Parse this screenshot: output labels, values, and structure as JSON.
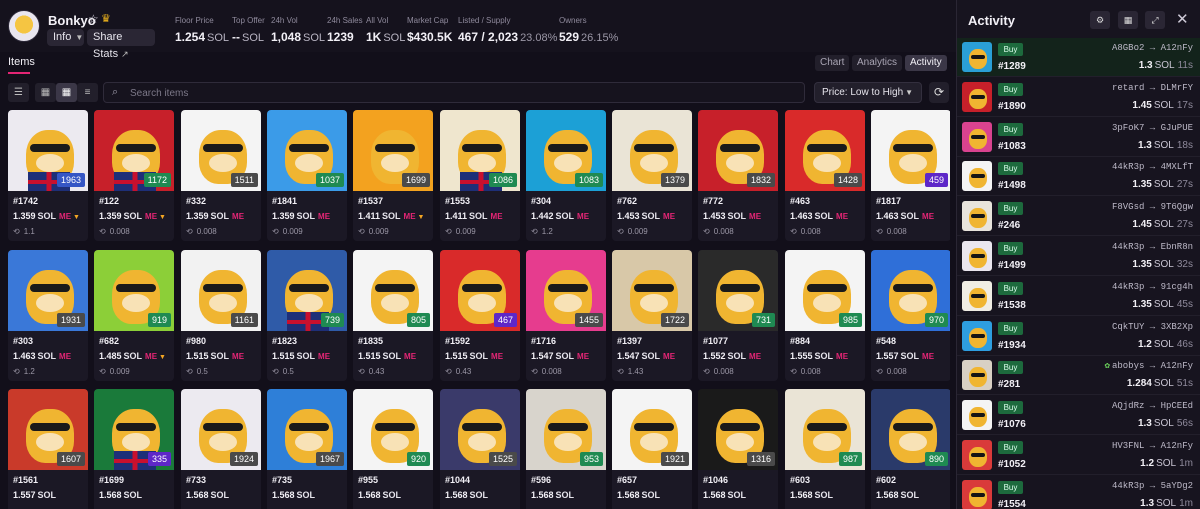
{
  "collection": {
    "name": "Bonkyo",
    "info_label": "Info",
    "share_label": "Share Stats"
  },
  "stats": [
    {
      "label": "Floor Price",
      "value": "1.254",
      "unit": "SOL",
      "pct": ""
    },
    {
      "label": "Top Offer",
      "value": "--",
      "unit": "SOL",
      "pct": ""
    },
    {
      "label": "24h Vol",
      "value": "1,048",
      "unit": "SOL",
      "pct": ""
    },
    {
      "label": "24h Sales",
      "value": "1239",
      "unit": "",
      "pct": ""
    },
    {
      "label": "All Vol",
      "value": "1K",
      "unit": "SOL",
      "pct": ""
    },
    {
      "label": "Market Cap",
      "value": "$430.5K",
      "unit": "",
      "pct": ""
    },
    {
      "label": "Listed / Supply",
      "value": "467 / 2,023",
      "unit": "",
      "pct": "23.08%"
    },
    {
      "label": "Owners",
      "value": "529",
      "unit": "",
      "pct": "26.15%"
    }
  ],
  "tabs": {
    "items": "Items"
  },
  "views": {
    "chart": "Chart",
    "analytics": "Analytics",
    "activity": "Activity"
  },
  "search": {
    "placeholder": "Search items"
  },
  "sort": {
    "selected": "Price: Low to High"
  },
  "unit": "SOL",
  "grid": [
    {
      "id": "#1742",
      "price": "1.359",
      "last": "1.1",
      "rank": "1963",
      "rank_color": "blue",
      "flag": true,
      "bg": "#eceaf0"
    },
    {
      "id": "#122",
      "price": "1.359",
      "last": "0.008",
      "rank": "1172",
      "rank_color": "green",
      "flag": true,
      "bg": "#c7202a"
    },
    {
      "id": "#332",
      "price": "1.359",
      "last": "0.008",
      "rank": "1511",
      "rank_color": "gray",
      "flag": false,
      "bg": "#f4f4f4"
    },
    {
      "id": "#1841",
      "price": "1.359",
      "last": "0.009",
      "rank": "1037",
      "rank_color": "green",
      "flag": false,
      "bg": "#3b9be8"
    },
    {
      "id": "#1537",
      "price": "1.411",
      "last": "0.009",
      "rank": "1699",
      "rank_color": "gray",
      "flag": false,
      "bg": "#f3a21f"
    },
    {
      "id": "#1553",
      "price": "1.411",
      "last": "0.009",
      "rank": "1086",
      "rank_color": "green",
      "flag": true,
      "bg": "#efe6ce"
    },
    {
      "id": "#304",
      "price": "1.442",
      "last": "1.2",
      "rank": "1083",
      "rank_color": "green",
      "flag": false,
      "bg": "#1ca0d6"
    },
    {
      "id": "#762",
      "price": "1.453",
      "last": "0.009",
      "rank": "1379",
      "rank_color": "gray",
      "flag": false,
      "bg": "#eae4d6"
    },
    {
      "id": "#772",
      "price": "1.453",
      "last": "0.008",
      "rank": "1832",
      "rank_color": "gray",
      "flag": false,
      "bg": "#c7202a"
    },
    {
      "id": "#463",
      "price": "1.463",
      "last": "0.008",
      "rank": "1428",
      "rank_color": "gray",
      "flag": false,
      "bg": "#d92a2a"
    },
    {
      "id": "#1817",
      "price": "1.463",
      "last": "0.008",
      "rank": "459",
      "rank_color": "purple",
      "flag": false,
      "bg": "#f4f4f4"
    },
    {
      "id": "#303",
      "price": "1.463",
      "last": "1.2",
      "rank": "1931",
      "rank_color": "gray",
      "flag": false,
      "bg": "#3a78d8"
    },
    {
      "id": "#682",
      "price": "1.485",
      "last": "0.009",
      "rank": "919",
      "rank_color": "green",
      "flag": false,
      "bg": "#8ccf38"
    },
    {
      "id": "#980",
      "price": "1.515",
      "last": "0.5",
      "rank": "1161",
      "rank_color": "gray",
      "flag": false,
      "bg": "#f2f2f2"
    },
    {
      "id": "#1823",
      "price": "1.515",
      "last": "0.5",
      "rank": "739",
      "rank_color": "green",
      "flag": true,
      "bg": "#2f5ba8"
    },
    {
      "id": "#1835",
      "price": "1.515",
      "last": "0.43",
      "rank": "805",
      "rank_color": "green",
      "flag": false,
      "bg": "#f4f4f4"
    },
    {
      "id": "#1592",
      "price": "1.515",
      "last": "0.43",
      "rank": "467",
      "rank_color": "purple",
      "flag": false,
      "bg": "#d92a2a"
    },
    {
      "id": "#1716",
      "price": "1.547",
      "last": "0.008",
      "rank": "1455",
      "rank_color": "gray",
      "flag": false,
      "bg": "#e63c8e"
    },
    {
      "id": "#1397",
      "price": "1.547",
      "last": "1.43",
      "rank": "1722",
      "rank_color": "gray",
      "flag": false,
      "bg": "#d8c8a8"
    },
    {
      "id": "#1077",
      "price": "1.552",
      "last": "0.008",
      "rank": "731",
      "rank_color": "green",
      "flag": false,
      "bg": "#2a2a2a"
    },
    {
      "id": "#884",
      "price": "1.555",
      "last": "0.008",
      "rank": "985",
      "rank_color": "green",
      "flag": false,
      "bg": "#f4f4f4"
    },
    {
      "id": "#548",
      "price": "1.557",
      "last": "0.008",
      "rank": "970",
      "rank_color": "green",
      "flag": false,
      "bg": "#2f6fd8"
    },
    {
      "id": "#1561",
      "price": "1.557",
      "last": "",
      "rank": "1607",
      "rank_color": "gray",
      "flag": false,
      "bg": "#c93a2a"
    },
    {
      "id": "#1699",
      "price": "1.568",
      "last": "",
      "rank": "335",
      "rank_color": "purple",
      "flag": true,
      "bg": "#1a7a3a"
    },
    {
      "id": "#733",
      "price": "1.568",
      "last": "",
      "rank": "1924",
      "rank_color": "gray",
      "flag": false,
      "bg": "#eceaf0"
    },
    {
      "id": "#735",
      "price": "1.568",
      "last": "",
      "rank": "1967",
      "rank_color": "gray",
      "flag": false,
      "bg": "#2e7fd8"
    },
    {
      "id": "#955",
      "price": "1.568",
      "last": "",
      "rank": "920",
      "rank_color": "green",
      "flag": false,
      "bg": "#f4f4f4"
    },
    {
      "id": "#1044",
      "price": "1.568",
      "last": "",
      "rank": "1525",
      "rank_color": "gray",
      "flag": false,
      "bg": "#3a3a6a"
    },
    {
      "id": "#596",
      "price": "1.568",
      "last": "",
      "rank": "953",
      "rank_color": "green",
      "flag": false,
      "bg": "#d8d4cc"
    },
    {
      "id": "#657",
      "price": "1.568",
      "last": "",
      "rank": "1921",
      "rank_color": "gray",
      "flag": false,
      "bg": "#f4f4f4"
    },
    {
      "id": "#1046",
      "price": "1.568",
      "last": "",
      "rank": "1316",
      "rank_color": "gray",
      "flag": false,
      "bg": "#1a1a1a"
    },
    {
      "id": "#603",
      "price": "1.568",
      "last": "",
      "rank": "987",
      "rank_color": "green",
      "flag": false,
      "bg": "#eae4d6"
    },
    {
      "id": "#602",
      "price": "1.568",
      "last": "",
      "rank": "890",
      "rank_color": "green",
      "flag": false,
      "bg": "#2a3a6a"
    }
  ],
  "activity": {
    "title": "Activity",
    "buy_label": "Buy",
    "rows": [
      {
        "id": "#1289",
        "from": "A8GBo2",
        "to": "A12nFy",
        "price": "1.3",
        "time": "11s",
        "leaf": false,
        "bg": "#2a9fd6"
      },
      {
        "id": "#1890",
        "from": "retard",
        "to": "DLMrFY",
        "price": "1.45",
        "time": "17s",
        "leaf": false,
        "bg": "#c7202a"
      },
      {
        "id": "#1083",
        "from": "3pFoK7",
        "to": "GJuPUE",
        "price": "1.3",
        "time": "18s",
        "leaf": false,
        "bg": "#d9438f"
      },
      {
        "id": "#1498",
        "from": "44kR3p",
        "to": "4MXLfT",
        "price": "1.35",
        "time": "27s",
        "leaf": false,
        "bg": "#f4f4f4"
      },
      {
        "id": "#246",
        "from": "F8VGsd",
        "to": "9T6Qgw",
        "price": "1.45",
        "time": "27s",
        "leaf": false,
        "bg": "#e8e4dc"
      },
      {
        "id": "#1499",
        "from": "44kR3p",
        "to": "EbnR8n",
        "price": "1.35",
        "time": "32s",
        "leaf": false,
        "bg": "#eae6ee"
      },
      {
        "id": "#1538",
        "from": "44kR3p",
        "to": "91cg4h",
        "price": "1.35",
        "time": "45s",
        "leaf": false,
        "bg": "#f0ede4"
      },
      {
        "id": "#1934",
        "from": "CqkTUY",
        "to": "3XB2Xp",
        "price": "1.2",
        "time": "46s",
        "leaf": false,
        "bg": "#2e9ee0"
      },
      {
        "id": "#281",
        "from": "abobys",
        "to": "A12nFy",
        "price": "1.284",
        "time": "51s",
        "leaf": true,
        "bg": "#d8d0c4"
      },
      {
        "id": "#1076",
        "from": "AQjdRz",
        "to": "HpCEEd",
        "price": "1.3",
        "time": "56s",
        "leaf": false,
        "bg": "#f4f4f4"
      },
      {
        "id": "#1052",
        "from": "HV3FNL",
        "to": "A12nFy",
        "price": "1.2",
        "time": "1m",
        "leaf": false,
        "bg": "#d93a3a"
      },
      {
        "id": "#1554",
        "from": "44kR3p",
        "to": "5aYDg2",
        "price": "1.3",
        "time": "1m",
        "leaf": false,
        "bg": "#d93a3a"
      }
    ]
  }
}
